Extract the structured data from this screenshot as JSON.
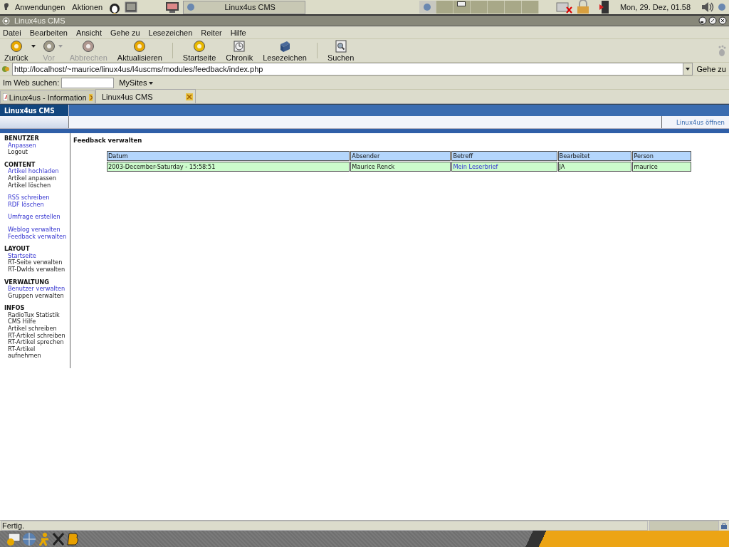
{
  "top_panel": {
    "menus": [
      "Anwendungen",
      "Aktionen"
    ],
    "task": "Linux4us CMS",
    "clock": "Mon, 29. Dez, 01.58"
  },
  "window": {
    "title": "Linux4us CMS"
  },
  "menubar": [
    "Datei",
    "Bearbeiten",
    "Ansicht",
    "Gehe zu",
    "Lesezeichen",
    "Reiter",
    "Hilfe"
  ],
  "toolbar": [
    {
      "kind": "back",
      "label": "Zurück",
      "disabled": false,
      "dropdown": true,
      "separator_after": false
    },
    {
      "kind": "forward",
      "label": "Vor",
      "disabled": true,
      "dropdown": true,
      "separator_after": false
    },
    {
      "kind": "stop",
      "label": "Abbrechen",
      "disabled": true,
      "dropdown": false,
      "separator_after": false
    },
    {
      "kind": "reload",
      "label": "Aktualisieren",
      "disabled": false,
      "dropdown": false,
      "separator_after": true
    },
    {
      "kind": "home",
      "label": "Startseite",
      "disabled": false,
      "dropdown": false,
      "separator_after": false
    },
    {
      "kind": "history",
      "label": "Chronik",
      "disabled": false,
      "dropdown": false,
      "separator_after": false
    },
    {
      "kind": "bookmarks",
      "label": "Lesezeichen",
      "disabled": false,
      "dropdown": false,
      "separator_after": true
    },
    {
      "kind": "search",
      "label": "Suchen",
      "disabled": false,
      "dropdown": false,
      "separator_after": false
    }
  ],
  "address_bar": {
    "url": "http://localhost/~maurice/linux4us/l4uscms/modules/feedback/index.php",
    "go_button": "Gehe zu"
  },
  "search_bar": {
    "label": "Im Web suchen:",
    "sites_menu": "MySites"
  },
  "tabs": [
    {
      "label": "Linux4us - Information",
      "selected": false
    },
    {
      "label": "Linux4us CMS",
      "selected": true
    }
  ],
  "page": {
    "logo": "Linux4us CMS",
    "header_link": "Linux4us öffnen",
    "heading": "Feedback verwalten",
    "sidebar": [
      {
        "title": "BENUTZER",
        "groups": [
          [
            {
              "label": "Anpassen",
              "link": true
            },
            {
              "label": "Logout",
              "link": false
            }
          ]
        ]
      },
      {
        "title": "CONTENT",
        "groups": [
          [
            {
              "label": "Artikel hochladen",
              "link": true
            },
            {
              "label": "Artikel anpassen",
              "link": false
            },
            {
              "label": "Artikel löschen",
              "link": false
            }
          ],
          [
            {
              "label": "RSS schreiben",
              "link": true
            },
            {
              "label": "RDF löschen",
              "link": true
            }
          ],
          [
            {
              "label": "Umfrage erstellen",
              "link": true
            }
          ],
          [
            {
              "label": "Weblog verwalten",
              "link": true
            },
            {
              "label": "Feedback verwalten",
              "link": true
            }
          ]
        ]
      },
      {
        "title": "LAYOUT",
        "groups": [
          [
            {
              "label": "Startseite",
              "link": true
            },
            {
              "label": "RT-Seite verwalten",
              "link": false
            },
            {
              "label": "RT-Dwlds verwalten",
              "link": false
            }
          ]
        ]
      },
      {
        "title": "VERWALTUNG",
        "groups": [
          [
            {
              "label": "Benutzer verwalten",
              "link": true
            },
            {
              "label": "Gruppen verwalten",
              "link": false
            }
          ]
        ]
      },
      {
        "title": "INFOS",
        "groups": [
          [
            {
              "label": "RadioTux Statistik",
              "link": false
            },
            {
              "label": "CMS Hilfe",
              "link": false
            },
            {
              "label": "Artikel schreiben",
              "link": false
            },
            {
              "label": "RT-Artikel schreiben",
              "link": false
            },
            {
              "label": "RT-Artikel sprechen",
              "link": false
            },
            {
              "label": "RT-Artikel aufnehmen",
              "link": false
            }
          ]
        ]
      }
    ],
    "table": {
      "columns": [
        "Datum",
        "Absender",
        "Betreff",
        "Bearbeitet",
        "Person"
      ],
      "rows": [
        [
          {
            "text": "2003-December-Saturday - 15:58:51",
            "link": false
          },
          {
            "text": "Maurice Renck",
            "link": false
          },
          {
            "text": "Mein Leserbrief",
            "link": true
          },
          {
            "text": "JA",
            "link": false
          },
          {
            "text": "maurice",
            "link": false
          }
        ]
      ]
    }
  },
  "status_bar": {
    "text": "Fertig."
  }
}
